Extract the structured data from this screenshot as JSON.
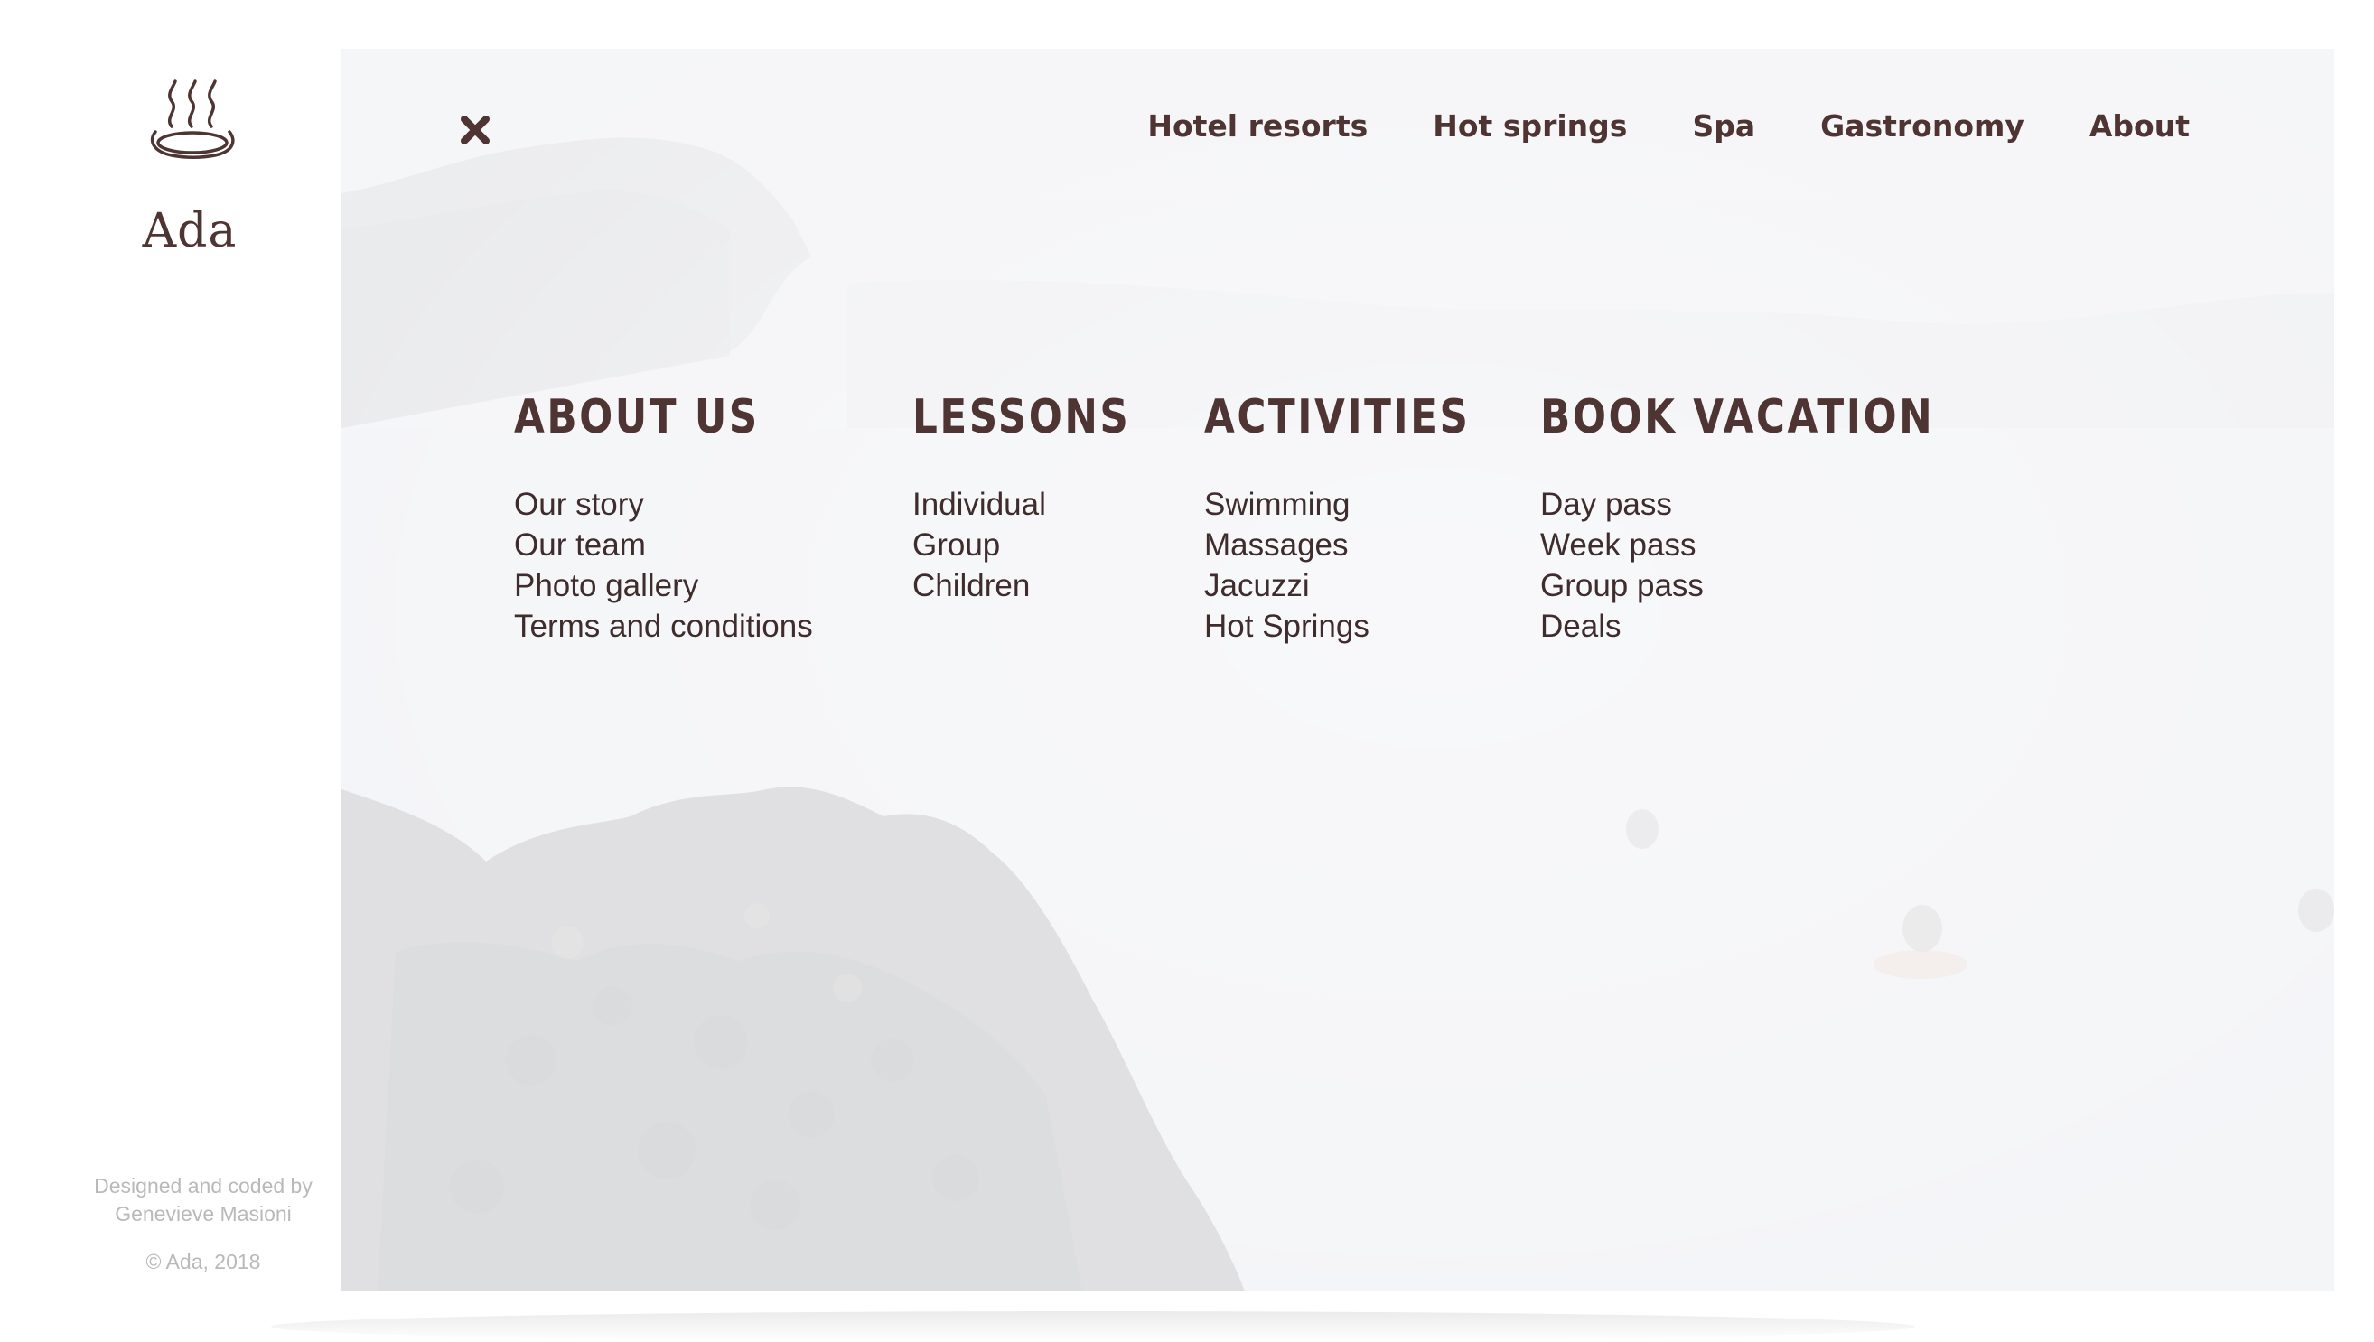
{
  "brand": {
    "name": "Ada",
    "logo_icon": "hot-spring-icon"
  },
  "footer": {
    "credit_line1": "Designed and coded by",
    "credit_line2": "Genevieve Masioni",
    "copyright": "© Ada, 2018"
  },
  "header": {
    "close_icon": "close-icon",
    "nav": [
      {
        "label": "Hotel resorts"
      },
      {
        "label": "Hot springs"
      },
      {
        "label": "Spa"
      },
      {
        "label": "Gastronomy"
      },
      {
        "label": "About"
      }
    ]
  },
  "menu": [
    {
      "title": "ABOUT US",
      "items": [
        "Our story",
        "Our team",
        "Photo gallery",
        "Terms and conditions"
      ]
    },
    {
      "title": "LESSONS",
      "items": [
        "Individual",
        "Group",
        "Children"
      ]
    },
    {
      "title": "ACTIVITIES",
      "items": [
        "Swimming",
        "Massages",
        "Jacuzzi",
        "Hot Springs"
      ]
    },
    {
      "title": "BOOK VACATION",
      "items": [
        "Day pass",
        "Week pass",
        "Group pass",
        "Deals"
      ]
    }
  ],
  "colors": {
    "text": "#4f3434",
    "muted": "#b9b9b9",
    "panel": "#f0f1f2"
  }
}
